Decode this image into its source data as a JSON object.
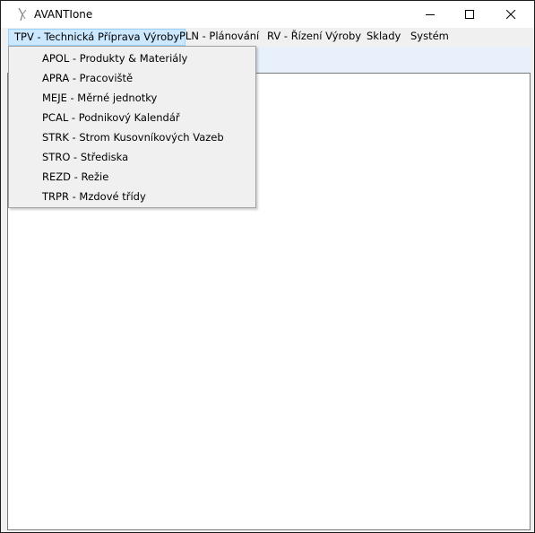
{
  "window": {
    "title": "AVANTIone",
    "controls": {
      "minimize_icon": "minimize-icon",
      "maximize_icon": "maximize-icon",
      "close_icon": "close-icon"
    }
  },
  "menubar": {
    "items": [
      {
        "label": "TPV - Technická Příprava Výroby"
      },
      {
        "label": "PLN - Plánování"
      },
      {
        "label": "RV - Řízení Výroby"
      },
      {
        "label": "Sklady"
      },
      {
        "label": "Systém"
      }
    ]
  },
  "dropdown": {
    "items": [
      {
        "label": "APOL - Produkty & Materiály"
      },
      {
        "label": "APRA - Pracoviště"
      },
      {
        "label": "MEJE - Měrné jednotky"
      },
      {
        "label": "PCAL - Podnikový Kalendář"
      },
      {
        "label": "STRK - Strom Kusovníkových Vazeb"
      },
      {
        "label": "STRO - Střediska"
      },
      {
        "label": "REZD - Režie"
      },
      {
        "label": "TRPR - Mzdové třídy"
      }
    ]
  },
  "colors": {
    "menu_active_bg": "#cce8ff",
    "menu_active_border": "#99d1ff",
    "toolbar_strip": "#e8f1fb",
    "window_border": "#1e1e1e"
  }
}
